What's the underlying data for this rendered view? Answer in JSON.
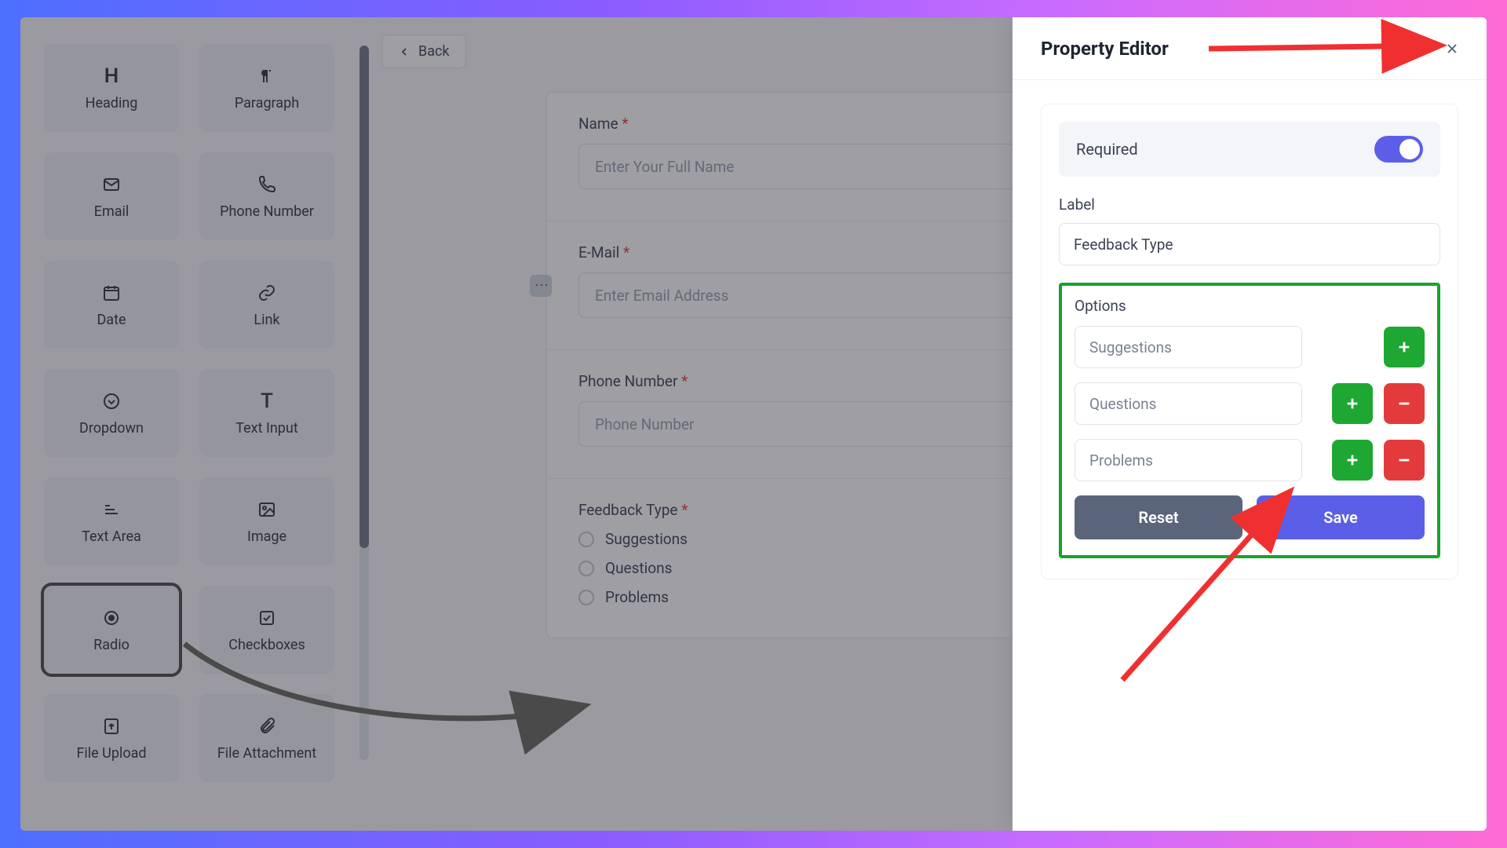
{
  "back": "Back",
  "elements": [
    {
      "label": "Heading",
      "icon": "H"
    },
    {
      "label": "Paragraph",
      "icon": "para"
    },
    {
      "label": "Email",
      "icon": "mail"
    },
    {
      "label": "Phone Number",
      "icon": "phone"
    },
    {
      "label": "Date",
      "icon": "date"
    },
    {
      "label": "Link",
      "icon": "link"
    },
    {
      "label": "Dropdown",
      "icon": "dropdown"
    },
    {
      "label": "Text Input",
      "icon": "T"
    },
    {
      "label": "Text Area",
      "icon": "textarea"
    },
    {
      "label": "Image",
      "icon": "image"
    },
    {
      "label": "Radio",
      "icon": "radio",
      "selected": true
    },
    {
      "label": "Checkboxes",
      "icon": "check"
    },
    {
      "label": "File Upload",
      "icon": "upload"
    },
    {
      "label": "File Attachment",
      "icon": "attach"
    }
  ],
  "form": {
    "fields": [
      {
        "label": "Name",
        "required": true,
        "placeholder": "Enter Your Full Name",
        "type": "text"
      },
      {
        "label": "E-Mail",
        "required": true,
        "placeholder": "Enter Email Address",
        "type": "text",
        "has_handle": true
      },
      {
        "label": "Phone Number",
        "required": true,
        "placeholder": "Phone Number",
        "type": "text"
      },
      {
        "label": "Feedback Type",
        "required": true,
        "type": "radio",
        "options": [
          "Suggestions",
          "Questions",
          "Problems"
        ]
      }
    ]
  },
  "panel": {
    "title": "Property Editor",
    "required_label": "Required",
    "required_on": true,
    "label_label": "Label",
    "label_value": "Feedback Type",
    "options_label": "Options",
    "options": [
      {
        "value": "Suggestions",
        "can_add": true,
        "can_del": false
      },
      {
        "value": "Questions",
        "can_add": true,
        "can_del": true
      },
      {
        "value": "Problems",
        "can_add": true,
        "can_del": true
      }
    ],
    "reset": "Reset",
    "save": "Save"
  }
}
